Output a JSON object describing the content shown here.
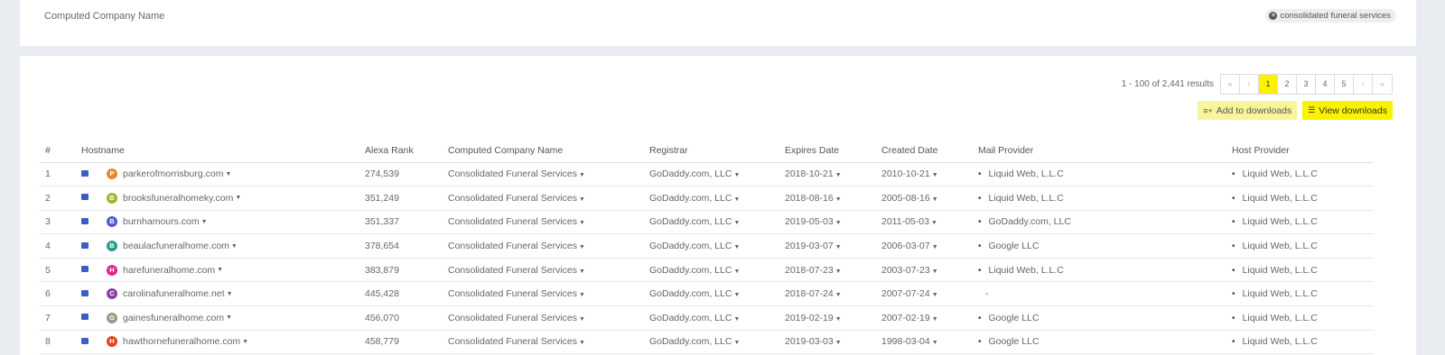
{
  "filter": {
    "label": "Computed Company Name",
    "chip": "consolidated funeral services"
  },
  "results": {
    "summary": "1 - 100 of 2,441 results",
    "pager": [
      "«",
      "‹",
      "1",
      "2",
      "3",
      "4",
      "5",
      "›",
      "»"
    ],
    "active_page": "1"
  },
  "actions": {
    "add_label": "Add to downloads",
    "view_label": "View downloads"
  },
  "columns": [
    "#",
    "Hostname",
    "Alexa Rank",
    "Computed Company Name",
    "Registrar",
    "Expires Date",
    "Created Date",
    "Mail Provider",
    "Host Provider"
  ],
  "rows": [
    {
      "n": "1",
      "host": "parkerofmorrisburg.com",
      "letter": "P",
      "color": "#e8862a",
      "rank": "274,539",
      "company": "Consolidated Funeral Services",
      "registrar": "GoDaddy.com, LLC",
      "expires": "2018-10-21",
      "created": "2010-10-21",
      "mail": "Liquid Web, L.L.C",
      "mail_bullet": "•",
      "hostp": "Liquid Web, L.L.C"
    },
    {
      "n": "2",
      "host": "brooksfuneralhomeky.com",
      "letter": "B",
      "color": "#a2b52c",
      "rank": "351,249",
      "company": "Consolidated Funeral Services",
      "registrar": "GoDaddy.com, LLC",
      "expires": "2018-08-16",
      "created": "2005-08-16",
      "mail": "Liquid Web, L.L.C",
      "mail_bullet": "•",
      "hostp": "Liquid Web, L.L.C"
    },
    {
      "n": "3",
      "host": "burnhamours.com",
      "letter": "B",
      "color": "#5458d6",
      "rank": "351,337",
      "company": "Consolidated Funeral Services",
      "registrar": "GoDaddy.com, LLC",
      "expires": "2019-05-03",
      "created": "2011-05-03",
      "mail": "GoDaddy.com, LLC",
      "mail_bullet": "•",
      "hostp": "Liquid Web, L.L.C"
    },
    {
      "n": "4",
      "host": "beaulacfuneralhome.com",
      "letter": "B",
      "color": "#2a9c86",
      "rank": "378,654",
      "company": "Consolidated Funeral Services",
      "registrar": "GoDaddy.com, LLC",
      "expires": "2019-03-07",
      "created": "2006-03-07",
      "mail": "Google LLC",
      "mail_bullet": "•",
      "hostp": "Liquid Web, L.L.C"
    },
    {
      "n": "5",
      "host": "harefuneralhome.com",
      "letter": "H",
      "color": "#e0258a",
      "rank": "383,879",
      "company": "Consolidated Funeral Services",
      "registrar": "GoDaddy.com, LLC",
      "expires": "2018-07-23",
      "created": "2003-07-23",
      "mail": "Liquid Web, L.L.C",
      "mail_bullet": "•",
      "hostp": "Liquid Web, L.L.C"
    },
    {
      "n": "6",
      "host": "carolinafuneralhome.net",
      "letter": "C",
      "color": "#8a3fa8",
      "rank": "445,428",
      "company": "Consolidated Funeral Services",
      "registrar": "GoDaddy.com, LLC",
      "expires": "2018-07-24",
      "created": "2007-07-24",
      "mail": "-",
      "mail_bullet": "",
      "hostp": "Liquid Web, L.L.C"
    },
    {
      "n": "7",
      "host": "gainesfuneralhome.com",
      "letter": "G",
      "color": "#9a9a86",
      "rank": "456,070",
      "company": "Consolidated Funeral Services",
      "registrar": "GoDaddy.com, LLC",
      "expires": "2019-02-19",
      "created": "2007-02-19",
      "mail": "Google LLC",
      "mail_bullet": "•",
      "hostp": "Liquid Web, L.L.C"
    },
    {
      "n": "8",
      "host": "hawthornefuneralhome.com",
      "letter": "H",
      "color": "#e8401c",
      "rank": "458,779",
      "company": "Consolidated Funeral Services",
      "registrar": "GoDaddy.com, LLC",
      "expires": "2019-03-03",
      "created": "1998-03-04",
      "mail": "Google LLC",
      "mail_bullet": "•",
      "hostp": "Liquid Web, L.L.C"
    }
  ]
}
